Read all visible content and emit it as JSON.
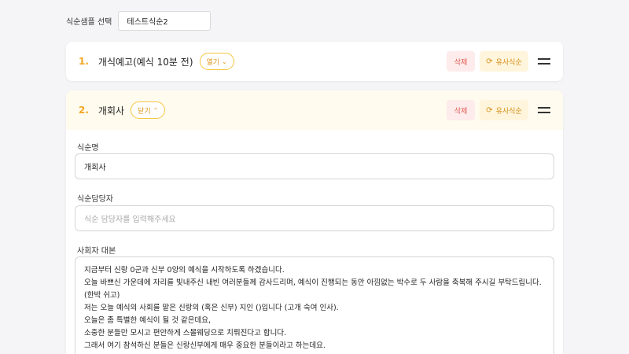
{
  "top": {
    "label": "식순샘플 선택",
    "selected": "테스트식순2"
  },
  "items": [
    {
      "num": "1.",
      "title": "개식예고(예식 10분 전)",
      "toggle": "열기",
      "delete": "삭제",
      "similar": "유사식순"
    },
    {
      "num": "2.",
      "title": "개회사",
      "toggle": "닫기",
      "delete": "삭제",
      "similar": "유사식순"
    }
  ],
  "form": {
    "name_label": "식순명",
    "name_value": "개회사",
    "manager_label": "식순담당자",
    "manager_placeholder": "식순 담당자를 입력해주세요",
    "script_label": "사회자 대본",
    "script_lines": [
      "지금부터 신랑 0군과 신부 0양의 예식을 시작하도록 하겠습니다.",
      "오늘 바쁘신 가운데에 자리를 빛내주신 내빈 여러분들께 감사드리며, 예식이 진행되는 동안 아낌없는 박수로 두 사람을 축복해 주시길 부탁드립니다.",
      "(한박 쉬고)",
      "저는 오늘 예식의 사회를 맡은 신랑의 (혹은 신부) 지인 ()입니다 (고개 숙여 인사).",
      "오늘은 좀 특별한 예식이 될 것 같은데요,",
      "소중한 분들만 모시고 편안하게 스몰웨딩으로 치뤄진다고 합니다.",
      "그래서 여기 참석하신 분들은 신랑신부에게 매우 중요한 분들이라고 하는데요."
    ]
  },
  "colors": {
    "accent": "#f5a623",
    "delete": "#e2554e",
    "similar": "#d4901a"
  }
}
